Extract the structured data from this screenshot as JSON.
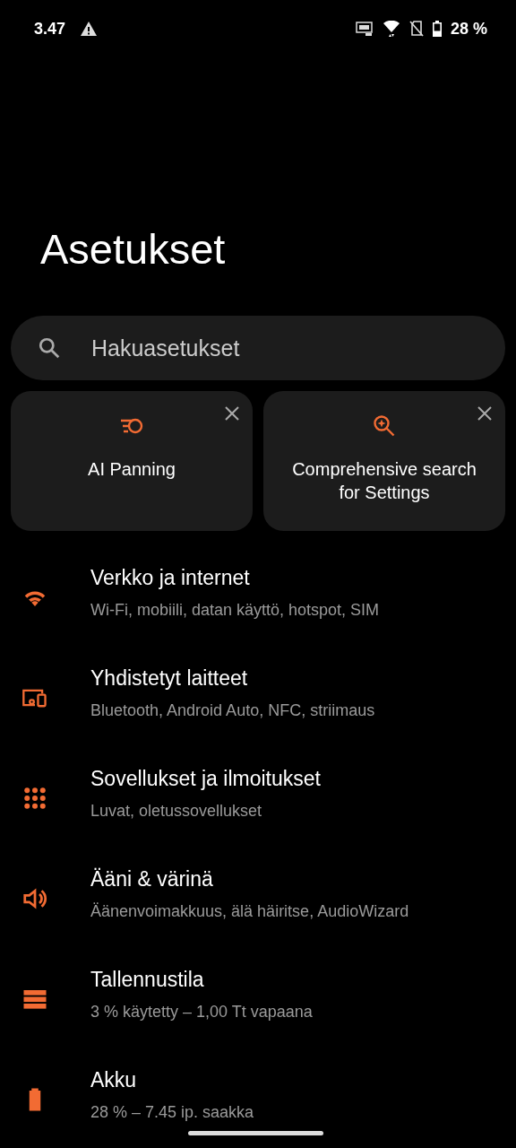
{
  "status_bar": {
    "time": "3.47",
    "battery": "28 %"
  },
  "title": "Asetukset",
  "search": {
    "placeholder": "Hakuasetukset"
  },
  "suggestions": [
    {
      "kind": "panning",
      "label": "AI Panning"
    },
    {
      "kind": "search",
      "label": "Comprehensive search for Settings"
    }
  ],
  "items": [
    {
      "kind": "wifi",
      "title": "Verkko ja internet",
      "subtitle": "Wi-Fi, mobiili, datan käyttö, hotspot, SIM"
    },
    {
      "kind": "devices",
      "title": "Yhdistetyt laitteet",
      "subtitle": "Bluetooth, Android Auto, NFC, striimaus"
    },
    {
      "kind": "apps",
      "title": "Sovellukset ja ilmoitukset",
      "subtitle": "Luvat, oletussovellukset"
    },
    {
      "kind": "sound",
      "title": "Ääni & värinä",
      "subtitle": "Äänenvoimakkuus, älä häiritse, AudioWizard"
    },
    {
      "kind": "storage",
      "title": "Tallennustila",
      "subtitle": "3 % käytetty – 1,00 Tt vapaana"
    },
    {
      "kind": "battery",
      "title": "Akku",
      "subtitle": "28 % – 7.45 ip. saakka"
    }
  ]
}
